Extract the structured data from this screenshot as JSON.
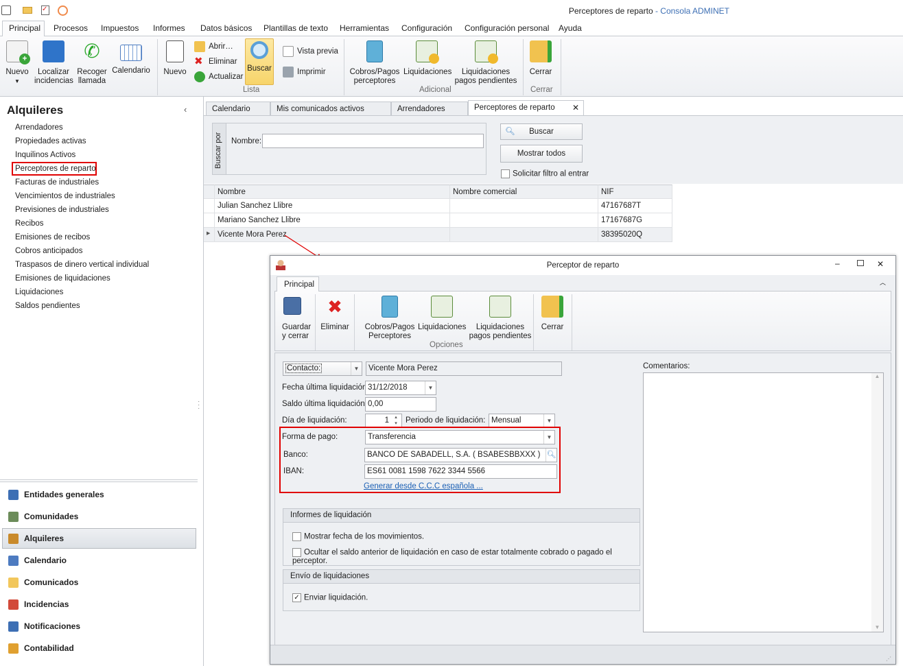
{
  "window": {
    "title": "Perceptores de reparto",
    "app": " - Consola ADMINET"
  },
  "menu_tabs": [
    "Principal",
    "Procesos",
    "Impuestos",
    "Informes",
    "Datos básicos",
    "Plantillas de texto",
    "Herramientas",
    "Configuración",
    "Configuración personal",
    "Ayuda"
  ],
  "ribbon": {
    "nuevo": "Nuevo",
    "localizar": [
      "Localizar",
      "incidencias"
    ],
    "recoger": [
      "Recoger",
      "llamada"
    ],
    "calendario": "Calendario",
    "nuevo2": "Nuevo",
    "abrir": "Abrir…",
    "eliminar": "Eliminar",
    "actualizar": "Actualizar",
    "buscar": "Buscar",
    "vista_previa": "Vista previa",
    "imprimir": "Imprimir",
    "grp_lista": "Lista",
    "cobros": [
      "Cobros/Pagos",
      "perceptores"
    ],
    "liquidaciones": "Liquidaciones",
    "liq_pend": [
      "Liquidaciones",
      "pagos pendientes"
    ],
    "grp_adicional": "Adicional",
    "cerrar": "Cerrar",
    "grp_cerrar": "Cerrar"
  },
  "sidebar": {
    "title": "Alquileres",
    "items": [
      "Arrendadores",
      "Propiedades activas",
      "Inquilinos Activos",
      "Perceptores de reparto",
      "Facturas de industriales",
      "Vencimientos de industriales",
      "Previsiones de industriales",
      "Recibos",
      "Emisiones de recibos",
      "Cobros anticipados",
      "Traspasos de dinero vertical individual",
      "Emisiones de liquidaciones",
      "Liquidaciones",
      "Saldos pendientes"
    ],
    "nav": [
      "Entidades generales",
      "Comunidades",
      "Alquileres",
      "Calendario",
      "Comunicados",
      "Incidencias",
      "Notificaciones",
      "Contabilidad"
    ]
  },
  "doc_tabs": [
    "Calendario",
    "Mis comunicados activos",
    "Arrendadores",
    "Perceptores de reparto"
  ],
  "search": {
    "group": "Buscar por",
    "nombre_label": "Nombre:",
    "nombre_value": "",
    "buscar": "Buscar",
    "mostrar_todos": "Mostrar todos",
    "solicitar": "Solicitar filtro al entrar"
  },
  "grid": {
    "columns": [
      "Nombre",
      "Nombre comercial",
      "NIF"
    ],
    "rows": [
      [
        "Julian Sanchez Llibre",
        "",
        "47167687T"
      ],
      [
        "Mariano Sanchez Llibre",
        "",
        "17167687G"
      ],
      [
        "Vicente Mora Perez",
        "",
        "38395020Q"
      ]
    ]
  },
  "dialog": {
    "title": "Perceptor de reparto",
    "tab": "Principal",
    "toolbar": {
      "guardar": [
        "Guardar",
        "y cerrar"
      ],
      "eliminar": "Eliminar",
      "cobros": [
        "Cobros/Pagos",
        "Perceptores"
      ],
      "liquidaciones": "Liquidaciones",
      "liq_pend": [
        "Liquidaciones",
        "pagos pendientes"
      ],
      "opciones": "Opciones",
      "cerrar": "Cerrar"
    },
    "form": {
      "contacto_label": "Contacto:",
      "contacto": "Vicente Mora Perez",
      "fecha_label": "Fecha última liquidación:",
      "fecha": "31/12/2018",
      "saldo_label": "Saldo última liquidación:",
      "saldo": "0,00",
      "dia_label": "Día de liquidación:",
      "dia": "1",
      "periodo_label": "Periodo de liquidación:",
      "periodo": "Mensual",
      "forma_label": "Forma de pago:",
      "forma": "Transferencia",
      "banco_label": "Banco:",
      "banco": "BANCO DE SABADELL, S.A. ( BSABESBBXXX )",
      "iban_label": "IBAN:",
      "iban": "ES61 0081 1598 7622 3344 5566",
      "generar": "Generar desde C.C.C española ...",
      "comentarios": "Comentarios:"
    },
    "informes": {
      "title": "Informes de liquidación",
      "opt1": "Mostrar fecha de los movimientos.",
      "opt2": "Ocultar el saldo anterior de liquidación en caso de estar totalmente cobrado o pagado el perceptor."
    },
    "envio": {
      "title": "Envío de liquidaciones",
      "opt1": "Enviar liquidación.",
      "opt1_checked": true
    }
  },
  "colors": {
    "highlight": "#e00000",
    "accent": "#f7d46a",
    "link": "#1a5fb4"
  }
}
